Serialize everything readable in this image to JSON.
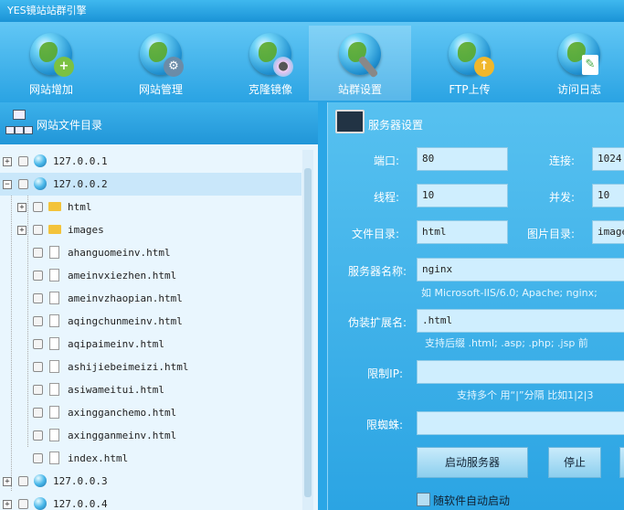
{
  "window": {
    "title": "YES镜站站群引擎"
  },
  "toolbar": {
    "items": [
      {
        "label": "网站增加",
        "icon": "globe-add-icon"
      },
      {
        "label": "网站管理",
        "icon": "globe-gear-icon"
      },
      {
        "label": "克隆镜像",
        "icon": "globe-disc-icon"
      },
      {
        "label": "站群设置",
        "icon": "globe-tools-icon",
        "active": true
      },
      {
        "label": "FTP上传",
        "icon": "globe-upload-icon"
      },
      {
        "label": "访问日志",
        "icon": "globe-log-icon"
      }
    ]
  },
  "sidebar": {
    "title": "网站文件目录",
    "tree": [
      {
        "label": "127.0.0.1",
        "type": "site",
        "expand": "+"
      },
      {
        "label": "127.0.0.2",
        "type": "site",
        "expand": "−",
        "selected": true
      },
      {
        "label": "html",
        "type": "folder",
        "expand": "+"
      },
      {
        "label": "images",
        "type": "folder",
        "expand": "+"
      },
      {
        "label": "ahanguomeinv.html",
        "type": "file"
      },
      {
        "label": "ameinvxiezhen.html",
        "type": "file"
      },
      {
        "label": "ameinvzhaopian.html",
        "type": "file"
      },
      {
        "label": "aqingchunmeinv.html",
        "type": "file"
      },
      {
        "label": "aqipaimeinv.html",
        "type": "file"
      },
      {
        "label": "ashijiebeimeizi.html",
        "type": "file"
      },
      {
        "label": "asiwameitui.html",
        "type": "file"
      },
      {
        "label": "axingganchemo.html",
        "type": "file"
      },
      {
        "label": "axingganmeinv.html",
        "type": "file"
      },
      {
        "label": "index.html",
        "type": "file"
      },
      {
        "label": "127.0.0.3",
        "type": "site",
        "expand": "+"
      },
      {
        "label": "127.0.0.4",
        "type": "site",
        "expand": "+"
      }
    ]
  },
  "server": {
    "title": "服务器设置",
    "port_label": "端口:",
    "port": "80",
    "conn_label": "连接:",
    "conn": "1024",
    "threads_label": "线程:",
    "threads": "10",
    "concurrency_label": "并发:",
    "concurrency": "10",
    "filedir_label": "文件目录:",
    "filedir": "html",
    "imgdir_label": "图片目录:",
    "imgdir": "images",
    "name_label": "服务器名称:",
    "name": "nginx",
    "name_hint": "如 Microsoft-IIS/6.0; Apache; nginx;",
    "ext_label": "伪装扩展名:",
    "ext": ".html",
    "ext_hint": "支持后缀 .html; .asp; .php; .jsp 前",
    "ip_label": "限制IP:",
    "ip": "",
    "ip_hint": "支持多个 用“|”分隔 比如1|2|3",
    "spider_label": "限蜘蛛:",
    "spider": "",
    "start_button": "启动服务器",
    "stop_button": "停止",
    "autostart_label": "随软件自动启动"
  }
}
